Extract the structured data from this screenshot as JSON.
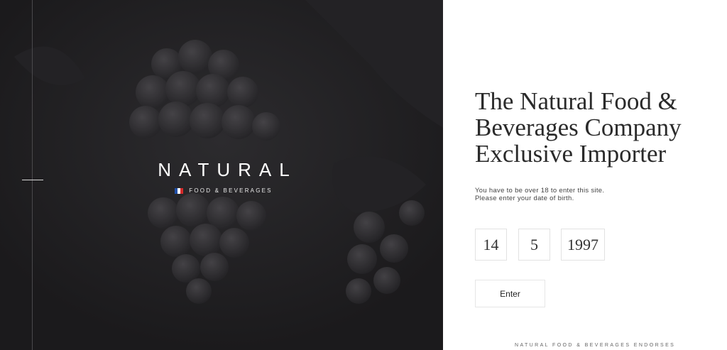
{
  "hero": {
    "logo_word": "NATURAL",
    "logo_subtitle": "FOOD & BEVERAGES",
    "flag_colors": [
      "#1f4fa8",
      "#ffffff",
      "#d42a2a"
    ],
    "background_color": "#1b1a1c"
  },
  "panel": {
    "title_line1": "The Natural Food &",
    "title_line2": "Beverages Company",
    "title_line3": "Exclusive Importer",
    "note_line1": "You have to be over 18 to enter this site.",
    "note_line2": "Please enter your date of birth.",
    "day_value": "14",
    "month_value": "5",
    "year_value": "1997",
    "enter_label": "Enter",
    "endorse_text": "NATURAL FOOD & BEVERAGES ENDORSES"
  }
}
